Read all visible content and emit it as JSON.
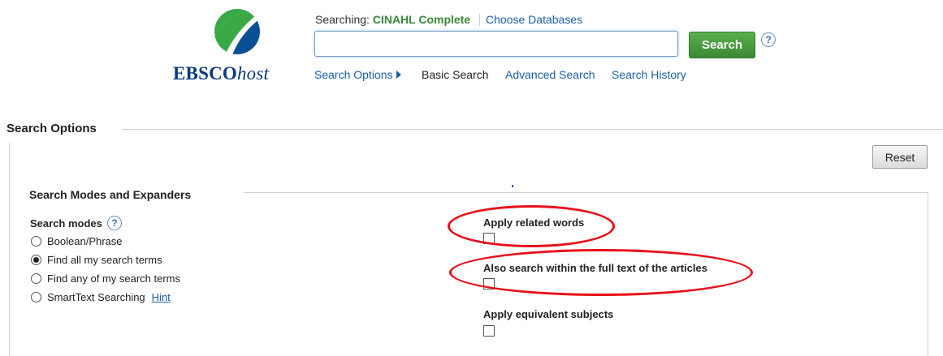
{
  "header": {
    "logo": {
      "brand_bold": "EBSCO",
      "brand_italic": "host",
      "colors": {
        "green": "#39a845",
        "blue": "#0a3a7a"
      }
    },
    "searching_prefix": "Searching:",
    "database_name": "CINAHL Complete",
    "choose_databases": "Choose Databases",
    "search_input": {
      "value": "",
      "placeholder": ""
    },
    "search_button": "Search",
    "help_icon": "?"
  },
  "nav": {
    "search_options": "Search Options",
    "basic_search": "Basic Search",
    "advanced_search": "Advanced Search",
    "search_history": "Search History"
  },
  "search_options": {
    "title": "Search Options",
    "reset_button": "Reset",
    "modes_expanders": {
      "title": "Search Modes and Expanders",
      "modes_label": "Search modes",
      "modes_help": "?",
      "modes": [
        {
          "label": "Boolean/Phrase",
          "selected": false
        },
        {
          "label": "Find all my search terms",
          "selected": true
        },
        {
          "label": "Find any of my search terms",
          "selected": false
        },
        {
          "label": "SmartText Searching",
          "selected": false
        }
      ],
      "hint_link": "Hint",
      "expanders": [
        {
          "label": "Apply related words",
          "checked": false,
          "highlighted": true
        },
        {
          "label": "Also search within the full text of the articles",
          "checked": false,
          "highlighted": true
        },
        {
          "label": "Apply equivalent subjects",
          "checked": false,
          "highlighted": false
        }
      ]
    }
  },
  "annotation_color": "#e8101a"
}
